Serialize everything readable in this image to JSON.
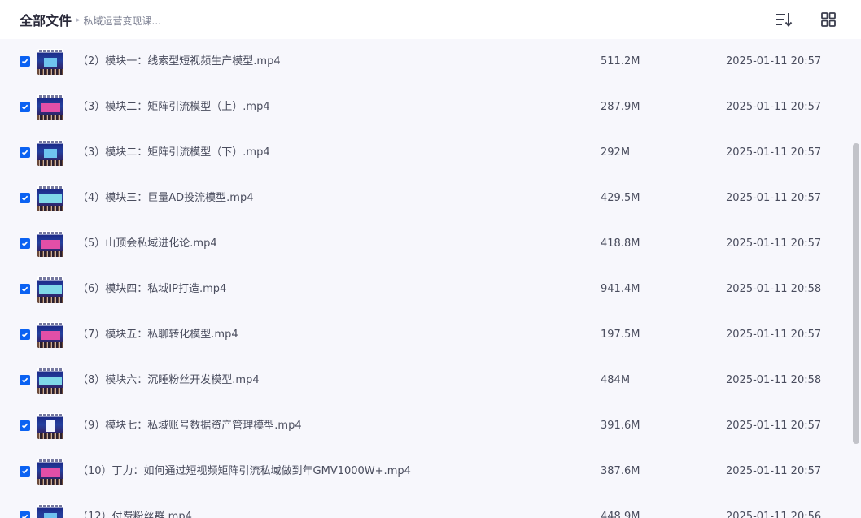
{
  "breadcrumb": {
    "root": "全部文件",
    "separator": "▸",
    "current": "私域运营变现课..."
  },
  "toolbar": {
    "sort_icon": "sort-list-icon",
    "view_icon": "grid-view-icon"
  },
  "colors": {
    "accent": "#0b62f2",
    "background": "#f7f7fc",
    "text": "#4a4d5e",
    "scrollbar": "#c2c3c9"
  },
  "files": [
    {
      "name": "（2）模块一：线索型短视频生产模型.mp4",
      "size": "511.2M",
      "time": "2025-01-11 20:57",
      "checked": true
    },
    {
      "name": "（3）模块二：矩阵引流模型（上）.mp4",
      "size": "287.9M",
      "time": "2025-01-11 20:57",
      "checked": true
    },
    {
      "name": "（3）模块二：矩阵引流模型（下）.mp4",
      "size": "292M",
      "time": "2025-01-11 20:57",
      "checked": true
    },
    {
      "name": "（4）模块三：巨量AD投流模型.mp4",
      "size": "429.5M",
      "time": "2025-01-11 20:57",
      "checked": true
    },
    {
      "name": "（5）山顶会私域进化论.mp4",
      "size": "418.8M",
      "time": "2025-01-11 20:57",
      "checked": true
    },
    {
      "name": "（6）模块四：私域IP打造.mp4",
      "size": "941.4M",
      "time": "2025-01-11 20:58",
      "checked": true
    },
    {
      "name": "（7）模块五：私聊转化模型.mp4",
      "size": "197.5M",
      "time": "2025-01-11 20:57",
      "checked": true
    },
    {
      "name": "（8）模块六：沉睡粉丝开发模型.mp4",
      "size": "484M",
      "time": "2025-01-11 20:58",
      "checked": true
    },
    {
      "name": "（9）模块七：私域账号数据资产管理模型.mp4",
      "size": "391.6M",
      "time": "2025-01-11 20:57",
      "checked": true
    },
    {
      "name": "（10）丁力：如何通过短视频矩阵引流私域做到年GMV1000W+.mp4",
      "size": "387.6M",
      "time": "2025-01-11 20:57",
      "checked": true
    },
    {
      "name": "（12）付费粉丝群.mp4",
      "size": "448.9M",
      "time": "2025-01-11 20:56",
      "checked": true
    }
  ]
}
